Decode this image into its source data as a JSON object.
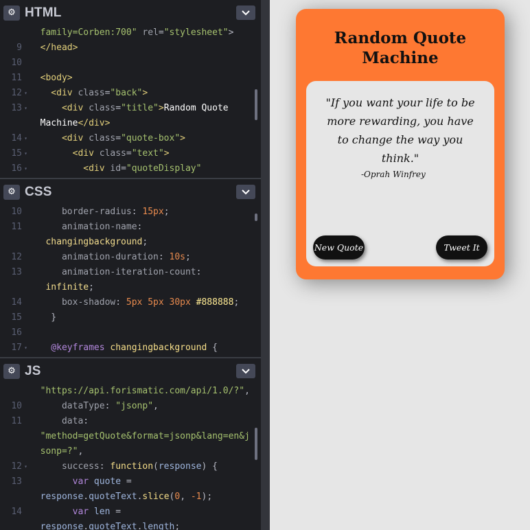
{
  "panels": {
    "html": {
      "title": "HTML",
      "scroll": {
        "top": 0.42,
        "size": 0.2
      }
    },
    "css": {
      "title": "CSS",
      "scroll": {
        "top": 0.06,
        "size": 0.05
      }
    },
    "js": {
      "title": "JS",
      "scroll": {
        "top": 0.3,
        "size": 0.22
      }
    }
  },
  "html_lines": [
    {
      "n": "",
      "f": "",
      "t": [
        [
          "  family=Corben:700\" ",
          "a"
        ],
        [
          "rel",
          "t"
        ],
        [
          "=",
          "p"
        ],
        [
          "\"stylesheet\"",
          "s"
        ],
        [
          ">",
          "p"
        ]
      ]
    },
    {
      "n": "9",
      "f": "",
      "t": [
        [
          "  </head>",
          "tg"
        ]
      ]
    },
    {
      "n": "10",
      "f": "",
      "t": []
    },
    {
      "n": "11",
      "f": "",
      "t": [
        [
          "  <body>",
          "tg"
        ]
      ]
    },
    {
      "n": "12",
      "f": "▾",
      "t": [
        [
          "    <div ",
          "tg"
        ],
        [
          "class",
          "t"
        ],
        [
          "=",
          "p"
        ],
        [
          "\"back\"",
          "s"
        ],
        [
          ">",
          "tg"
        ]
      ]
    },
    {
      "n": "13",
      "f": "▾",
      "t": [
        [
          "      <div ",
          "tg"
        ],
        [
          "class",
          "t"
        ],
        [
          "=",
          "p"
        ],
        [
          "\"title\"",
          "s"
        ],
        [
          ">",
          "tg"
        ],
        [
          "Random Quote",
          "w"
        ]
      ]
    },
    {
      "n": "",
      "f": "",
      "t": [
        [
          "  Machine",
          "w"
        ],
        [
          "</div>",
          "tg"
        ]
      ]
    },
    {
      "n": "14",
      "f": "▾",
      "t": [
        [
          "      <div ",
          "tg"
        ],
        [
          "class",
          "t"
        ],
        [
          "=",
          "p"
        ],
        [
          "\"quote-box\"",
          "s"
        ],
        [
          ">",
          "tg"
        ]
      ]
    },
    {
      "n": "15",
      "f": "▾",
      "t": [
        [
          "        <div ",
          "tg"
        ],
        [
          "class",
          "t"
        ],
        [
          "=",
          "p"
        ],
        [
          "\"text\"",
          "s"
        ],
        [
          ">",
          "tg"
        ]
      ]
    },
    {
      "n": "16",
      "f": "▾",
      "t": [
        [
          "          <div ",
          "tg"
        ],
        [
          "id",
          "t"
        ],
        [
          "=",
          "p"
        ],
        [
          "\"quoteDisplay\"",
          "s"
        ]
      ]
    }
  ],
  "css_lines": [
    {
      "n": "10",
      "f": "",
      "t": [
        [
          "      border-radius",
          "t"
        ],
        [
          ": ",
          "p"
        ],
        [
          "15px",
          "v"
        ],
        [
          ";",
          "p"
        ]
      ]
    },
    {
      "n": "11",
      "f": "",
      "t": [
        [
          "      animation-name",
          "t"
        ],
        [
          ":",
          "p"
        ]
      ]
    },
    {
      "n": "",
      "f": "",
      "t": [
        [
          "   changingbackground",
          "y"
        ],
        [
          ";",
          "p"
        ]
      ]
    },
    {
      "n": "12",
      "f": "",
      "t": [
        [
          "      animation-duration",
          "t"
        ],
        [
          ": ",
          "p"
        ],
        [
          "10s",
          "v"
        ],
        [
          ";",
          "p"
        ]
      ]
    },
    {
      "n": "13",
      "f": "",
      "t": [
        [
          "      animation-iteration-count",
          "t"
        ],
        [
          ":",
          "p"
        ]
      ]
    },
    {
      "n": "",
      "f": "",
      "t": [
        [
          "   infinite",
          "y"
        ],
        [
          ";",
          "p"
        ]
      ]
    },
    {
      "n": "14",
      "f": "",
      "t": [
        [
          "      box-shadow",
          "t"
        ],
        [
          ": ",
          "p"
        ],
        [
          "5px 5px 30px ",
          "v"
        ],
        [
          "#888888",
          "hx"
        ],
        [
          ";",
          "p"
        ]
      ]
    },
    {
      "n": "15",
      "f": "",
      "t": [
        [
          "    }",
          "p"
        ]
      ]
    },
    {
      "n": "16",
      "f": "",
      "t": []
    },
    {
      "n": "17",
      "f": "▾",
      "t": [
        [
          "    @keyframes ",
          "kw"
        ],
        [
          "changingbackground",
          "fn"
        ],
        [
          " {",
          "p"
        ]
      ]
    }
  ],
  "js_lines": [
    {
      "n": "",
      "f": "",
      "t": [
        [
          "  \"https://api.forismatic.com/api/1.0/?\"",
          "s"
        ],
        [
          ",",
          "p"
        ]
      ]
    },
    {
      "n": "10",
      "f": "",
      "t": [
        [
          "      dataType",
          "t"
        ],
        [
          ": ",
          "p"
        ],
        [
          "\"jsonp\"",
          "s"
        ],
        [
          ",",
          "p"
        ]
      ]
    },
    {
      "n": "11",
      "f": "",
      "t": [
        [
          "      data",
          "t"
        ],
        [
          ":",
          "p"
        ]
      ]
    },
    {
      "n": "",
      "f": "",
      "t": [
        [
          "  \"method=getQuote&format=jsonp&lang=en&j",
          "s"
        ]
      ]
    },
    {
      "n": "",
      "f": "",
      "t": [
        [
          "  sonp=?\"",
          "s"
        ],
        [
          ",",
          "p"
        ]
      ]
    },
    {
      "n": "12",
      "f": "▾",
      "t": [
        [
          "      success",
          "t"
        ],
        [
          ": ",
          "p"
        ],
        [
          "function",
          "fn"
        ],
        [
          "(",
          "p"
        ],
        [
          "response",
          "vr"
        ],
        [
          ") {",
          "p"
        ]
      ]
    },
    {
      "n": "13",
      "f": "",
      "t": [
        [
          "        var ",
          "kw"
        ],
        [
          "quote",
          "vr"
        ],
        [
          " =",
          "p"
        ]
      ]
    },
    {
      "n": "",
      "f": "",
      "t": [
        [
          "  response",
          "vr"
        ],
        [
          ".",
          "p"
        ],
        [
          "quoteText",
          "vr"
        ],
        [
          ".",
          "p"
        ],
        [
          "slice",
          "fn"
        ],
        [
          "(",
          "p"
        ],
        [
          "0",
          "v"
        ],
        [
          ", ",
          "p"
        ],
        [
          "-1",
          "v"
        ],
        [
          ");",
          "p"
        ]
      ]
    },
    {
      "n": "14",
      "f": "",
      "t": [
        [
          "        var ",
          "kw"
        ],
        [
          "len",
          "vr"
        ],
        [
          " =",
          "p"
        ]
      ]
    },
    {
      "n": "",
      "f": "",
      "t": [
        [
          "  response",
          "vr"
        ],
        [
          ".",
          "p"
        ],
        [
          "quoteText",
          "vr"
        ],
        [
          ".",
          "p"
        ],
        [
          "length",
          "vr"
        ],
        [
          ";",
          "p"
        ]
      ]
    }
  ],
  "preview": {
    "title": "Random Quote Machine",
    "quote": "\"If you want your life to be more rewarding, you have to change the way you think.\"",
    "author": "-Oprah Winfrey",
    "new_quote_label": "New Quote",
    "tweet_label": "Tweet It",
    "colors": {
      "card": "#fe7832",
      "button": "#111111",
      "quote_box": "#e6e6e6"
    }
  }
}
